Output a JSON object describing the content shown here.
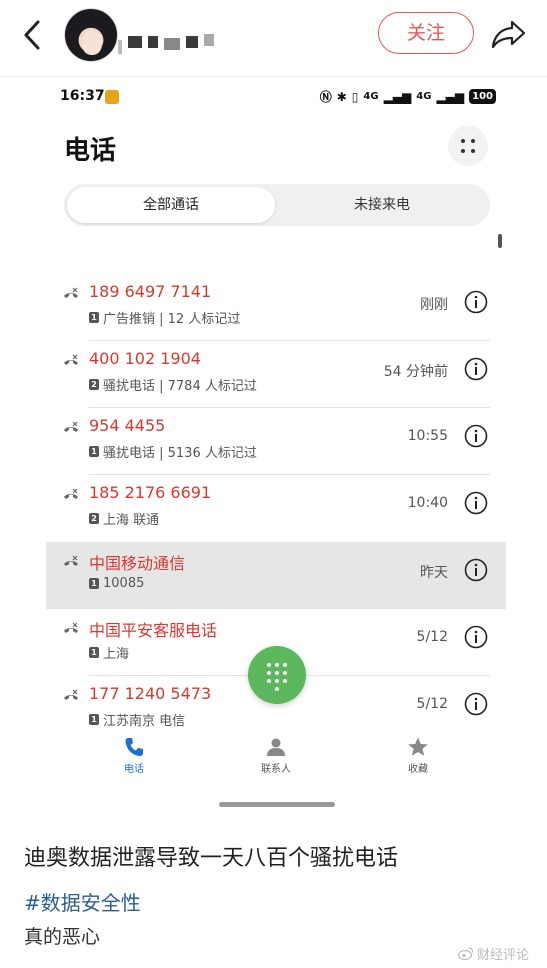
{
  "header": {
    "follow_label": "关注",
    "accent_color": "#e8585a"
  },
  "phone": {
    "status": {
      "time": "16:37",
      "network_1": "4G",
      "network_2": "4G",
      "battery": "100"
    },
    "title": "电话",
    "tabs": [
      {
        "label": "全部通话",
        "active": true
      },
      {
        "label": "未接来电",
        "active": false
      }
    ],
    "calls": [
      {
        "number": "189 6497 7141",
        "sim": "1",
        "detail": "广告推销 | 12 人标记过",
        "time": "刚刚",
        "highlighted": false
      },
      {
        "number": "400 102 1904",
        "sim": "2",
        "detail": "骚扰电话 | 7784 人标记过",
        "time": "54 分钟前",
        "highlighted": false
      },
      {
        "number": "954 4455",
        "sim": "1",
        "detail": "骚扰电话 | 5136 人标记过",
        "time": "10:55",
        "highlighted": false
      },
      {
        "number": "185 2176 6691",
        "sim": "2",
        "detail": "上海 联通",
        "time": "10:40",
        "highlighted": false
      },
      {
        "number": "中国移动通信",
        "sim": "1",
        "detail": "10085",
        "time": "昨天",
        "highlighted": true
      },
      {
        "number": "中国平安客服电话",
        "sim": "1",
        "detail": "上海",
        "time": "5/12",
        "highlighted": false
      },
      {
        "number": "177 1240 5473",
        "sim": "1",
        "detail": "江苏南京 电信",
        "time": "5/12",
        "highlighted": false
      }
    ],
    "call_color": "#d9382f",
    "fab_color": "#5cb85c",
    "nav": [
      {
        "label": "电话",
        "icon": "phone-icon",
        "active": true
      },
      {
        "label": "联系人",
        "icon": "contacts-icon",
        "active": false
      },
      {
        "label": "收藏",
        "icon": "star-icon",
        "active": false
      }
    ],
    "nav_active_color": "#1d6fd6"
  },
  "post": {
    "title": "迪奥数据泄露导致一天八百个骚扰电话",
    "hashtag": "#数据安全性",
    "body": "真的恶心"
  },
  "watermark": "财经评论"
}
